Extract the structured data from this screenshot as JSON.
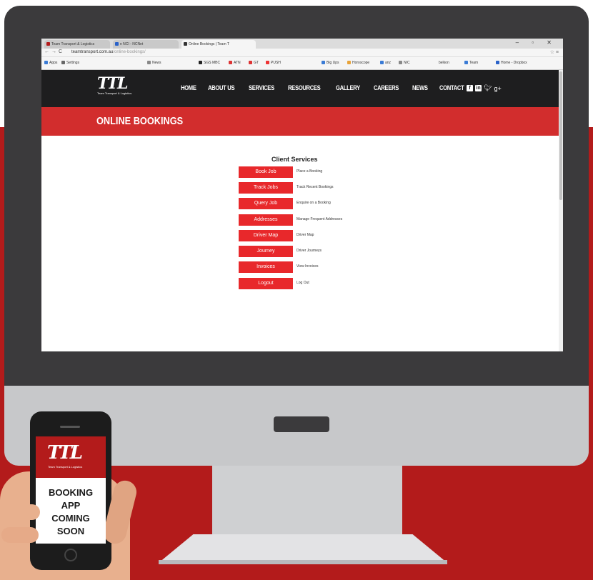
{
  "browser": {
    "tabs": [
      {
        "label": "Team Transport & Logistics"
      },
      {
        "label": "n NCI - NCNet"
      },
      {
        "label": "Online Bookings | Team T"
      }
    ],
    "window_controls": "– ▫ ✕",
    "url_domain": "teamtransport.com.au",
    "url_path": "/online-bookings/",
    "bookmarks": [
      "Apps",
      "Settings",
      "News",
      "SGS MBC",
      "ATN",
      "GT",
      "PUSH",
      "Big Ups",
      "Horoscope",
      "anz",
      "NIC",
      "belkon",
      "Team",
      "Home - Dropbox"
    ]
  },
  "site": {
    "logo_text": "TTL",
    "logo_subtitle": "Team Transport & Logistics",
    "nav": [
      "HOME",
      "ABOUT US",
      "SERVICES",
      "RESOURCES",
      "GALLERY",
      "CAREERS",
      "NEWS",
      "CONTACT"
    ],
    "social_icons": [
      "facebook-icon",
      "linkedin-icon",
      "twitter-icon",
      "google-plus-icon"
    ],
    "banner_title": "ONLINE BOOKINGS"
  },
  "client_services": {
    "title": "Client Services",
    "items": [
      {
        "button": "Book Job",
        "description": "Place a Booking"
      },
      {
        "button": "Track Jobs",
        "description": "Track Recent Bookings"
      },
      {
        "button": "Query Job",
        "description": "Enquire on a Booking"
      },
      {
        "button": "Addresses",
        "description": "Manage Frequent Addresses"
      },
      {
        "button": "Driver Map",
        "description": "Driver Map"
      },
      {
        "button": "Journey",
        "description": "Driver Journeys"
      },
      {
        "button": "Invoices",
        "description": "View Invoices"
      },
      {
        "button": "Logout",
        "description": "Log Out"
      }
    ]
  },
  "phone": {
    "logo_text": "TTL",
    "logo_subtitle": "Team Transport & Logistics",
    "message_lines": [
      "BOOKING",
      "APP",
      "COMING",
      "SOON"
    ]
  },
  "colors": {
    "brand_red": "#d22d2d",
    "button_red": "#e8282b",
    "header_dark": "#1e1e1f",
    "monitor_bezel": "#3b3a3c"
  }
}
